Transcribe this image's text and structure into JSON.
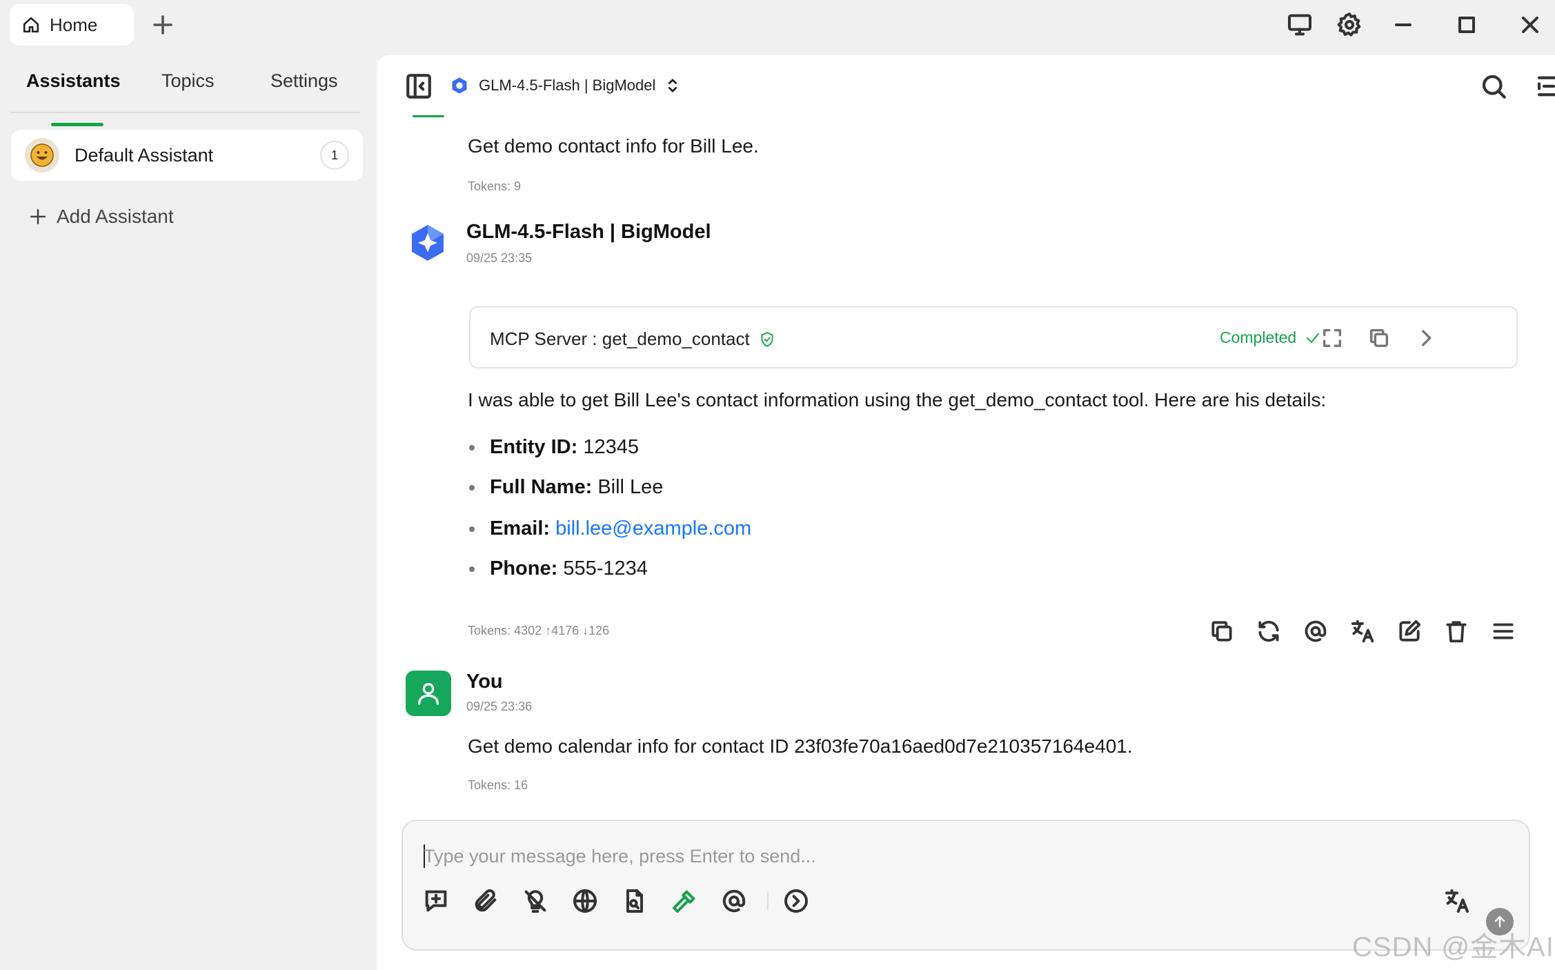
{
  "titlebar": {
    "home_tab": "Home"
  },
  "sidebar": {
    "tabs": [
      {
        "label": "Assistants"
      },
      {
        "label": "Topics"
      },
      {
        "label": "Settings"
      }
    ],
    "assistant": {
      "name": "Default Assistant",
      "count": "1"
    },
    "add_assistant": "Add Assistant"
  },
  "header": {
    "model": "GLM-4.5-Flash | BigModel"
  },
  "messages": {
    "first_user": {
      "text": "Get demo contact info for Bill Lee.",
      "tokens": "Tokens: 9"
    },
    "assistant": {
      "sender": "GLM-4.5-Flash | BigModel",
      "time": "09/25 23:35",
      "tool": {
        "title": "MCP Server : get_demo_contact",
        "status": "Completed"
      },
      "intro": "I was able to get Bill Lee's contact information using the get_demo_contact tool. Here are his details:",
      "details": [
        {
          "key": "Entity ID:",
          "value": "12345"
        },
        {
          "key": "Full Name:",
          "value": "Bill Lee"
        },
        {
          "key": "Email:",
          "value": "bill.lee@example.com"
        },
        {
          "key": "Phone:",
          "value": "555-1234"
        }
      ],
      "tokens": "Tokens: 4302 ↑4176 ↓126"
    },
    "second_user": {
      "sender": "You",
      "time": "09/25 23:36",
      "text": "Get demo calendar info for contact ID 23f03fe70a16aed0d7e210357164e401.",
      "tokens": "Tokens: 16"
    }
  },
  "input": {
    "placeholder": "Type your message here, press Enter to send..."
  },
  "watermark": "CSDN @金木AI",
  "colors": {
    "accent": "#16a34a",
    "link": "#1677ff",
    "panel": "#ffffff",
    "background": "#f0f0f0"
  }
}
